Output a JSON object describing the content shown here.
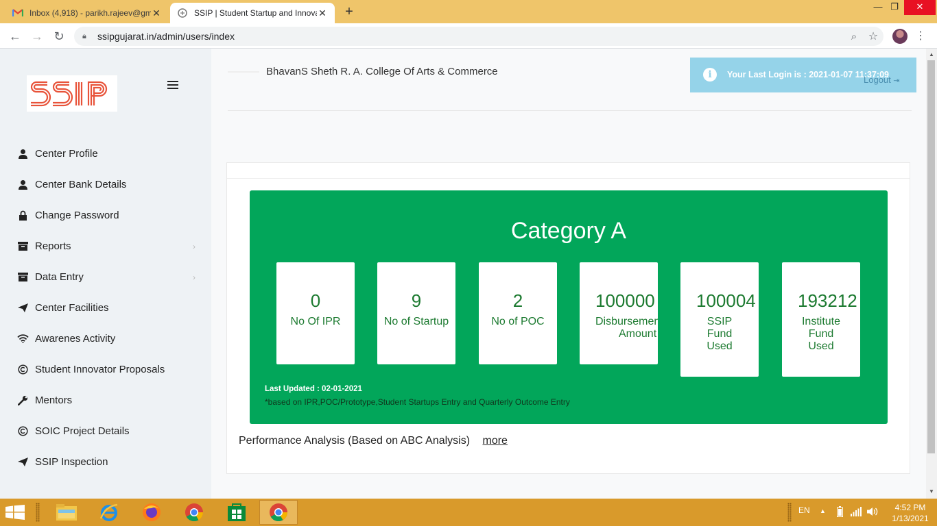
{
  "browser": {
    "tabs": [
      {
        "title": "Inbox (4,918) - parikh.rajeev@gm",
        "active": false,
        "favicon": "gmail-icon"
      },
      {
        "title": "SSIP | Student Startup and Innova",
        "active": true,
        "favicon": "ssip-favicon-icon"
      }
    ],
    "url": "ssipgujarat.in/admin/users/index"
  },
  "sidebar": {
    "logo_text": "SSIP",
    "items": [
      {
        "label": "Center Profile",
        "icon": "user-icon",
        "has_submenu": false
      },
      {
        "label": "Center Bank Details",
        "icon": "user-icon",
        "has_submenu": false
      },
      {
        "label": "Change Password",
        "icon": "lock-icon",
        "has_submenu": false
      },
      {
        "label": "Reports",
        "icon": "archive-icon",
        "has_submenu": true
      },
      {
        "label": "Data Entry",
        "icon": "archive-icon",
        "has_submenu": true
      },
      {
        "label": "Center Facilities",
        "icon": "send-icon",
        "has_submenu": false
      },
      {
        "label": "Awarenes Activity",
        "icon": "wifi-icon",
        "has_submenu": false
      },
      {
        "label": "Student Innovator Proposals",
        "icon": "copyright-icon",
        "has_submenu": false
      },
      {
        "label": "Mentors",
        "icon": "wrench-icon",
        "has_submenu": false
      },
      {
        "label": "SOIC Project Details",
        "icon": "copyright-icon",
        "has_submenu": false
      },
      {
        "label": "SSIP Inspection",
        "icon": "send-icon",
        "has_submenu": false
      }
    ]
  },
  "header": {
    "college_name": "BhavanS Sheth R. A. College Of Arts & Commerce",
    "last_login": "Your Last Login is : 2021-01-07 11:37:09",
    "logout_label": "Logout"
  },
  "dashboard": {
    "category_title": "Category A",
    "cards": [
      {
        "value": "0",
        "label": "No Of IPR"
      },
      {
        "value": "9",
        "label": "No of Startup"
      },
      {
        "value": "2",
        "label": "No of POC"
      },
      {
        "value": "100000",
        "label": "Disbursement Amount"
      },
      {
        "value": "100004",
        "label": "SSIP Fund Used"
      },
      {
        "value": "193212",
        "label": "Institute Fund Used"
      }
    ],
    "last_updated": "Last Updated : 02-01-2021",
    "note": "*based on IPR,POC/Prototype,Student Startups Entry and Quarterly Outcome Entry",
    "performance_label": "Performance Analysis (Based on ABC Analysis)",
    "more_label": "more"
  },
  "taskbar": {
    "language": "EN",
    "time": "4:52 PM",
    "date": "1/13/2021"
  },
  "colors": {
    "tabbar": "#efc56a",
    "sidebar": "#eef2f5",
    "category_green": "#02a65a",
    "card_text": "#1c7a30",
    "login_box": "#95d3e9",
    "taskbar": "#d99a2b",
    "logo_orange": "#e8533a"
  }
}
